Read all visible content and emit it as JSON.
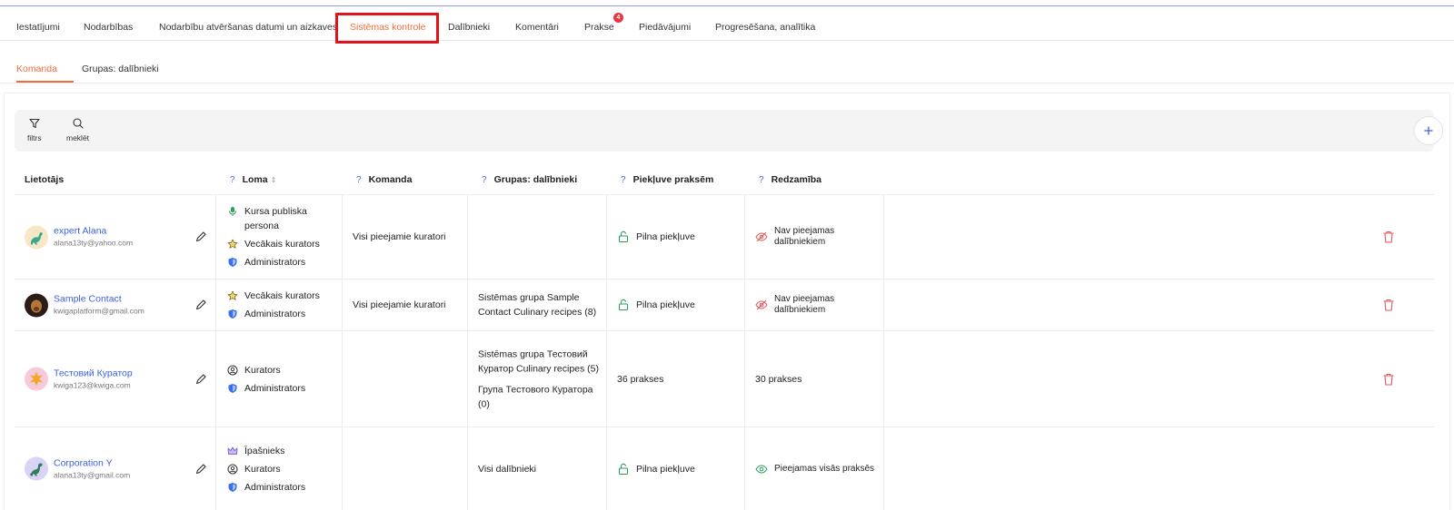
{
  "tabs": [
    {
      "label": "Iestatījumi"
    },
    {
      "label": "Nodarbības"
    },
    {
      "label": "Nodarbību atvēršanas datumi un aizkaves"
    },
    {
      "label": "Sistēmas kontrole"
    },
    {
      "label": "Dalībnieki"
    },
    {
      "label": "Komentāri"
    },
    {
      "label": "Prakse",
      "badge": "4"
    },
    {
      "label": "Piedāvājumi"
    },
    {
      "label": "Progresēšana, analītika"
    }
  ],
  "subtabs": [
    {
      "label": "Komanda"
    },
    {
      "label": "Grupas: dalībnieki"
    }
  ],
  "toolbar": {
    "filter_label": "filtrs",
    "search_label": "meklēt"
  },
  "table": {
    "headers": {
      "user": "Lietotājs",
      "role": "Loma",
      "team": "Komanda",
      "groups": "Grupas: dalībnieki",
      "access": "Piekļuve praksēm",
      "visibility": "Redzamība",
      "help_mark": "?"
    },
    "rows": [
      {
        "name": "expert Alana",
        "email": "alana13ty@yahoo.com",
        "roles": [
          {
            "icon": "microphone-icon",
            "label": "Kursa publiska persona"
          },
          {
            "icon": "star-icon",
            "label": "Vecākais kurators"
          },
          {
            "icon": "shield-icon",
            "label": "Administrators"
          }
        ],
        "team": "Visi pieejamie kuratori",
        "groups": [],
        "access": "Pilna piekļuve",
        "visibility": "Nav pieejamas dalībniekiem"
      },
      {
        "name": "Sample Contact",
        "email": "kwigaplatform@gmail.com",
        "roles": [
          {
            "icon": "star-icon",
            "label": "Vecākais kurators"
          },
          {
            "icon": "shield-icon",
            "label": "Administrators"
          }
        ],
        "team": "Visi pieejamie kuratori",
        "groups": [
          "Sistēmas grupa Sample Contact Culinary recipes (8)"
        ],
        "access": "Pilna piekļuve",
        "visibility": "Nav pieejamas dalībniekiem"
      },
      {
        "name": "Тестовий Куратор",
        "email": "kwiga123@kwiga.com",
        "roles": [
          {
            "icon": "user-circle-icon",
            "label": "Kurators"
          },
          {
            "icon": "shield-icon",
            "label": "Administrators"
          }
        ],
        "team": "",
        "groups": [
          "Sistēmas grupa Тестовий Куратор Culinary recipes (5)",
          "Група Тестового Куратора (0)"
        ],
        "access": "36 prakses",
        "visibility": "30 prakses"
      },
      {
        "name": "Corporation Y",
        "email": "alana13ty@gmail.com",
        "roles": [
          {
            "icon": "crown-icon",
            "label": "Īpašnieks"
          },
          {
            "icon": "user-circle-icon",
            "label": "Kurators"
          },
          {
            "icon": "shield-icon",
            "label": "Administrators"
          }
        ],
        "team": "",
        "groups": [
          "Visi dalībnieki"
        ],
        "access": "Pilna piekļuve",
        "visibility": "Pieejamas visās praksēs"
      }
    ]
  }
}
